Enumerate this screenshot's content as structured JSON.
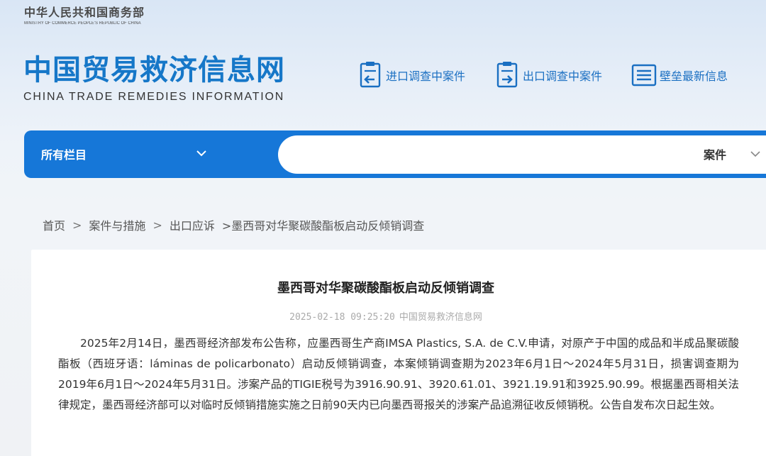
{
  "ministry": {
    "name_cn": "中华人民共和国商务部",
    "name_en": "MINISTRY OF COMMERCE PEOPLE'S REPUBLIC OF CHINA"
  },
  "logo": {
    "name_cn": "中国贸易救济信息网",
    "name_en": "CHINA TRADE REMEDIES INFORMATION"
  },
  "quick_links": [
    {
      "label": "进口调查中案件",
      "icon": "import-case-icon"
    },
    {
      "label": "出口调查中案件",
      "icon": "export-case-icon"
    },
    {
      "label": "壁垒最新信息",
      "icon": "barrier-news-icon"
    }
  ],
  "search": {
    "category_label": "所有栏目",
    "query": "",
    "type_label": "案件"
  },
  "breadcrumb": {
    "home": "首页",
    "level1": "案件与措施",
    "level2": "出口应诉",
    "current": ">墨西哥对华聚碳酸酯板启动反倾销调查"
  },
  "article": {
    "title": "墨西哥对华聚碳酸酯板启动反倾销调查",
    "datetime": "2025-02-18 09:25:20",
    "source": "中国贸易救济信息网",
    "body": "2025年2月14日，墨西哥经济部发布公告称，应墨西哥生产商IMSA Plastics, S.A. de C.V.申请，对原产于中国的成品和半成品聚碳酸酯板（西班牙语：láminas de policarbonato）启动反倾销调查，本案倾销调查期为2023年6月1日～2024年5月31日，损害调查期为2019年6月1日～2024年5月31日。涉案产品的TIGIE税号为3916.90.91、3920.61.01、3921.19.91和3925.90.99。根据墨西哥相关法律规定，墨西哥经济部可以对临时反倾销措施实施之日前90天内已向墨西哥报关的涉案产品追溯征收反倾销税。公告自发布次日起生效。"
  },
  "colors": {
    "brand_blue": "#1677d8",
    "logo_blue": "#1677c8",
    "link_blue": "#1a6fc2"
  }
}
